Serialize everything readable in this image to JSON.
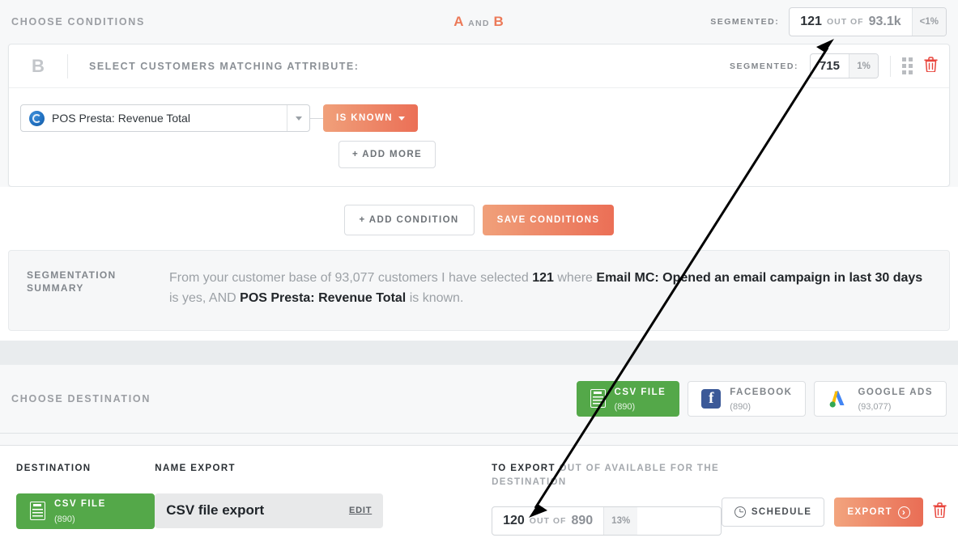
{
  "conditions": {
    "title": "CHOOSE CONDITIONS",
    "ab": {
      "a": "A",
      "and": "AND",
      "b": "B"
    },
    "segmented_label": "SEGMENTED:",
    "counter": {
      "value": "121",
      "of": "OUT OF",
      "total": "93.1k",
      "percent": "<1%"
    }
  },
  "condition_card": {
    "letter": "B",
    "title": "SELECT CUSTOMERS MATCHING ATTRIBUTE:",
    "segmented_label": "SEGMENTED:",
    "counter": {
      "value": "715",
      "percent": "1%"
    },
    "grid_icon": "grid-dots-icon",
    "delete_icon": "trash-icon",
    "attribute": {
      "icon": "data-source-icon",
      "value": "POS Presta: Revenue Total",
      "operator": "IS KNOWN"
    },
    "add_more_label": "+ ADD MORE"
  },
  "actions": {
    "add_condition": "+ ADD CONDITION",
    "save_conditions": "SAVE CONDITIONS"
  },
  "summary": {
    "label_line1": "SEGMENTATION",
    "label_line2": "SUMMARY",
    "text": {
      "p1": "From your customer base of 93,077 customers I have selected ",
      "count": "121",
      "p2": " where ",
      "cond1": "Email MC: Opened an email campaign in last 30 days",
      "p3": " is yes, AND ",
      "cond2": "POS Presta: Revenue Total",
      "p4": " is known."
    }
  },
  "destination": {
    "title": "CHOOSE DESTINATION",
    "options": [
      {
        "name": "CSV FILE",
        "count": "(890)",
        "icon": "csv-file-icon",
        "active": true
      },
      {
        "name": "FACEBOOK",
        "count": "(890)",
        "icon": "facebook-icon",
        "active": false
      },
      {
        "name": "GOOGLE ADS",
        "count": "(93,077)",
        "icon": "google-ads-icon",
        "active": false
      }
    ]
  },
  "bottom": {
    "destination_label": "DESTINATION",
    "destination_chip": {
      "name": "CSV FILE",
      "count": "(890)",
      "icon": "csv-file-icon"
    },
    "name_export_label": "NAME EXPORT",
    "export_name": "CSV file export",
    "edit_label": "EDIT",
    "to_export_label_strong": "TO EXPORT",
    "to_export_label_rest": " OUT OF AVAILABLE FOR THE DESTINATION",
    "counter": {
      "value": "120",
      "of": "OUT OF",
      "total": "890",
      "percent": "13%"
    },
    "schedule_label": "SCHEDULE",
    "export_label": "EXPORT",
    "delete_icon": "trash-icon"
  },
  "colors": {
    "accent_orange": "#eb6f56",
    "green": "#54a849",
    "red": "#e8453c",
    "muted": "#9b9ea3"
  }
}
